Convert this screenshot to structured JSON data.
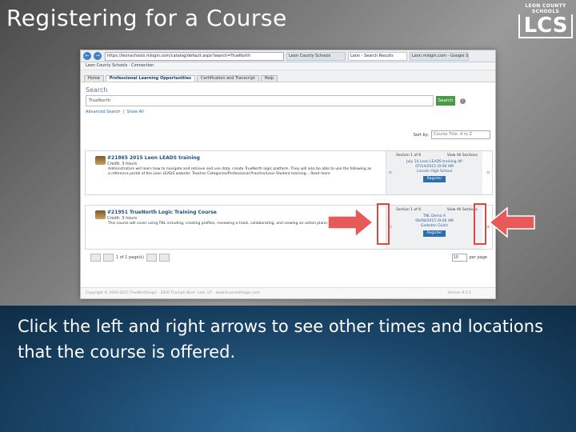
{
  "slide": {
    "title": "Registering for a Course",
    "caption": "Click the left and right arrows to see other times and locations that the course is offered.",
    "logo_line1": "LEON COUNTY SCHOOLS",
    "logo_line2": "LCS"
  },
  "browser": {
    "url": "https://leonschools.mlogin.com/catalog/default.aspx?search=TrueNorth",
    "tabs": [
      "Leon County Schools",
      "Leon - Search Results",
      "Leon.mlogin.com - Google Search"
    ],
    "favorites": "Leon County Schools · Connection"
  },
  "app": {
    "nav": [
      "Home",
      "Professional Learning Opportunities",
      "Certification and Transcript",
      "Help"
    ],
    "search_label": "Search",
    "search_value": "TrueNorth",
    "search_button": "Search",
    "advanced_link": "Advanced Search",
    "show_all_link": "Show All",
    "sort_label": "Sort by:",
    "sort_value": "Course Title: A to Z",
    "courses": [
      {
        "title": "#21865 2015 Leon LEADS training",
        "credit": "Credit: 3 hours",
        "description": "Administrators will learn how to navigate and retrieve and use data, create TrueNorth logic platform. They will also be able to use the following as a reference portal of the Leon LEADS website: Teacher Categories/Professional Practice/Leon Student learning... Read more",
        "section_header": "Section 1 of 6",
        "view_all": "View All Sections",
        "section_lines": [
          "July 14 Leon LEADS training AP",
          "07/14/2015 (9:00 AM",
          "Lincoln High School"
        ],
        "register": "Register"
      },
      {
        "title": "#21951 TrueNorth Logic Training Course",
        "credit": "Credit: 3 hours",
        "description": "This course will cover using TNL including, creating profiles, reviewing a track, collaborating, and viewing an action planning tool.",
        "section_header": "Section 1 of 6",
        "view_all": "View All Sections",
        "section_lines": [
          "TNL Demo A",
          "06/08/2015 (9:00 AM",
          "Gadsden Gulch"
        ],
        "register": "Register"
      }
    ],
    "arrow_left": "«",
    "arrow_right": "»",
    "pager_text": "1 of 1 page(s)",
    "per_page_value": "10",
    "per_page_label": "per page",
    "footer_left": "Copyright © 2003-2015 TrueNorthLogic · 3450 Triumph Blvd · Lehi, UT · www.truenorthlogic.com",
    "footer_right": "Version 9.1.1"
  }
}
